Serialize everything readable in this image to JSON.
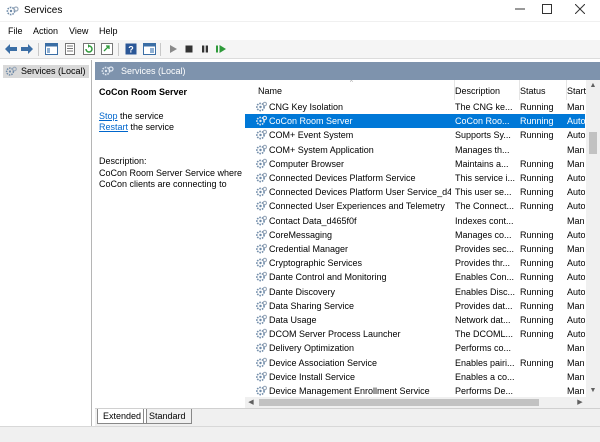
{
  "window": {
    "title": "Services"
  },
  "menu": [
    "File",
    "Action",
    "View",
    "Help"
  ],
  "toolbar": {
    "icons": [
      "back-arrow-icon",
      "forward-arrow-icon",
      "show-console-tree-icon",
      "properties-icon",
      "refresh-icon",
      "export-list-icon",
      "help-icon",
      "show-hide-action-pane-icon",
      "start-service-icon",
      "stop-service-icon",
      "pause-service-icon",
      "restart-service-icon"
    ]
  },
  "tree": {
    "root_label": "Services (Local)"
  },
  "pane_header": {
    "title": "Services (Local)"
  },
  "detail": {
    "service_name": "CoCon Room Server",
    "stop_link": "Stop",
    "stop_rest": " the service",
    "restart_link": "Restart",
    "restart_rest": " the service",
    "description_label": "Description:",
    "description": "CoCon Room Server Service where CoCon clients are connecting to"
  },
  "columns": {
    "name": "Name",
    "description": "Description",
    "status": "Status",
    "startup": "Start"
  },
  "services": [
    {
      "name": "CNG Key Isolation",
      "description": "The CNG ke...",
      "status": "Running",
      "startup": "Man"
    },
    {
      "name": "CoCon Room Server",
      "description": "CoCon Roo...",
      "status": "Running",
      "startup": "Auto",
      "selected": true
    },
    {
      "name": "COM+ Event System",
      "description": "Supports Sy...",
      "status": "Running",
      "startup": "Auto"
    },
    {
      "name": "COM+ System Application",
      "description": "Manages th...",
      "status": "",
      "startup": "Man"
    },
    {
      "name": "Computer Browser",
      "description": "Maintains a...",
      "status": "Running",
      "startup": "Man"
    },
    {
      "name": "Connected Devices Platform Service",
      "description": "This service i...",
      "status": "Running",
      "startup": "Auto"
    },
    {
      "name": "Connected Devices Platform User Service_d4...",
      "description": "This user se...",
      "status": "Running",
      "startup": "Auto"
    },
    {
      "name": "Connected User Experiences and Telemetry",
      "description": "The Connect...",
      "status": "Running",
      "startup": "Auto"
    },
    {
      "name": "Contact Data_d465f0f",
      "description": "Indexes cont...",
      "status": "",
      "startup": "Man"
    },
    {
      "name": "CoreMessaging",
      "description": "Manages co...",
      "status": "Running",
      "startup": "Auto"
    },
    {
      "name": "Credential Manager",
      "description": "Provides sec...",
      "status": "Running",
      "startup": "Man"
    },
    {
      "name": "Cryptographic Services",
      "description": "Provides thr...",
      "status": "Running",
      "startup": "Auto"
    },
    {
      "name": "Dante Control and Monitoring",
      "description": "Enables Con...",
      "status": "Running",
      "startup": "Auto"
    },
    {
      "name": "Dante Discovery",
      "description": "Enables Disc...",
      "status": "Running",
      "startup": "Auto"
    },
    {
      "name": "Data Sharing Service",
      "description": "Provides dat...",
      "status": "Running",
      "startup": "Man"
    },
    {
      "name": "Data Usage",
      "description": "Network dat...",
      "status": "Running",
      "startup": "Auto"
    },
    {
      "name": "DCOM Server Process Launcher",
      "description": "The DCOML...",
      "status": "Running",
      "startup": "Auto"
    },
    {
      "name": "Delivery Optimization",
      "description": "Performs co...",
      "status": "",
      "startup": "Man"
    },
    {
      "name": "Device Association Service",
      "description": "Enables pairi...",
      "status": "Running",
      "startup": "Man"
    },
    {
      "name": "Device Install Service",
      "description": "Enables a co...",
      "status": "",
      "startup": "Man"
    },
    {
      "name": "Device Management Enrollment Service",
      "description": "Performs De...",
      "status": "",
      "startup": "Man"
    }
  ],
  "tabs": [
    "Extended",
    "Standard"
  ],
  "colors": {
    "selection": "#0078d7",
    "pane_header": "#7e93ad",
    "link": "#0066cc"
  }
}
